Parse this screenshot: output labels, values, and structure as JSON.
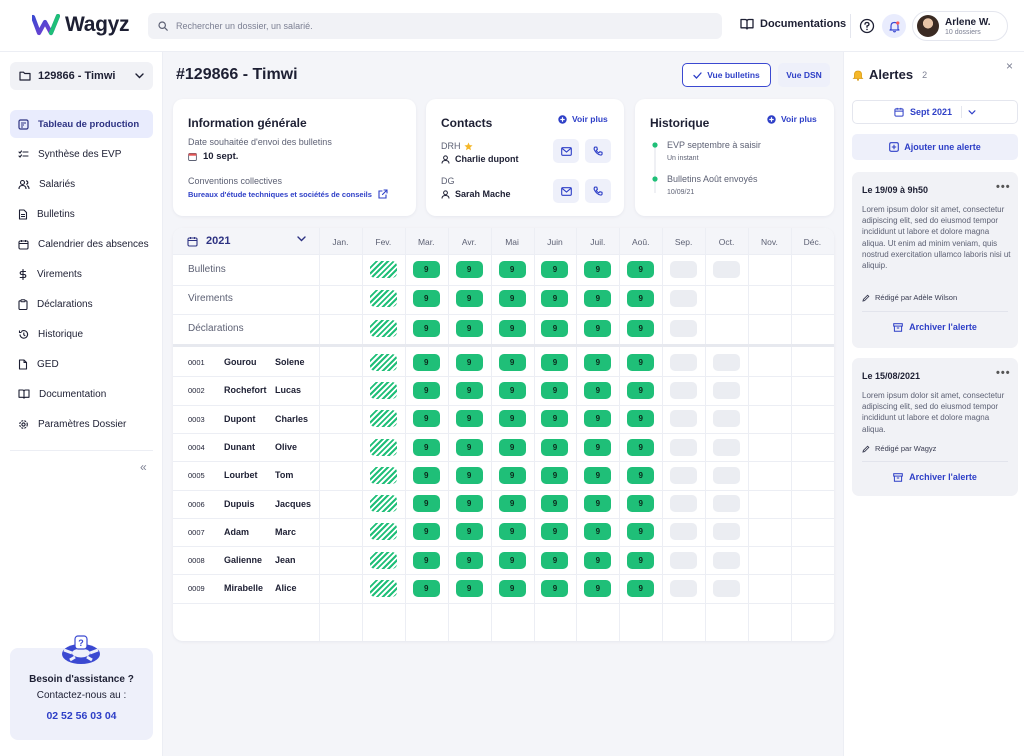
{
  "brand": {
    "name": "Wagyz"
  },
  "search": {
    "placeholder": "Rechercher un dossier, un salarié."
  },
  "header": {
    "documentations": "Documentations"
  },
  "user": {
    "name": "Arlene W.",
    "sub": "10 dossiers"
  },
  "sidebar": {
    "folder": "129866 - Timwi",
    "items": [
      {
        "label": "Tableau de production",
        "icon": "dashboard-icon",
        "active": true
      },
      {
        "label": "Synthèse des EVP",
        "icon": "tasks-icon"
      },
      {
        "label": "Salariés",
        "icon": "users-icon"
      },
      {
        "label": "Bulletins",
        "icon": "document-icon"
      },
      {
        "label": "Calendrier des absences",
        "icon": "calendar-icon"
      },
      {
        "label": "Virements",
        "icon": "dollar-icon"
      },
      {
        "label": "Déclarations",
        "icon": "clipboard-icon"
      },
      {
        "label": "Historique",
        "icon": "history-icon"
      },
      {
        "label": "GED",
        "icon": "file-icon"
      },
      {
        "label": "Documentation",
        "icon": "book-icon"
      },
      {
        "label": "Paramètres Dossier",
        "icon": "gear-icon"
      }
    ],
    "collapse": "«",
    "assist": {
      "title": "Besoin d'assistance ?",
      "sub": "Contactez-nous au :",
      "phone": "02 52 56 03 04"
    }
  },
  "main": {
    "title": "#129866 - Timwi",
    "btn_bulletins": "Vue bulletins",
    "btn_dsn": "Vue DSN",
    "info": {
      "title": "Information générale",
      "date_label": "Date souhaitée d'envoi des bulletins",
      "date_value": "10 sept.",
      "conv_label": "Conventions collectives",
      "conv_link": "Bureaux  d'étude techniques et sociétés de conseils"
    },
    "contacts": {
      "title": "Contacts",
      "voir": "Voir plus",
      "c1_role": "DRH",
      "c1_name": "Charlie dupont",
      "c2_role": "DG",
      "c2_name": "Sarah Mache"
    },
    "historique": {
      "title": "Historique",
      "voir": "Voir plus",
      "e1_title": "EVP septembre à saisir",
      "e1_time": "Un instant",
      "e2_title": "Bulletins Août envoyés",
      "e2_time": "10/09/21"
    }
  },
  "grid": {
    "year": "2021",
    "months": [
      "Jan.",
      "Fev.",
      "Mar.",
      "Avr.",
      "Mai",
      "Juin",
      "Juil.",
      "Aoû.",
      "Sep.",
      "Oct.",
      "Nov.",
      "Déc."
    ],
    "month_states": [
      "none",
      "hatched",
      "done",
      "done",
      "done",
      "done",
      "done",
      "done",
      "pending",
      "pending",
      "none",
      "none"
    ],
    "badge": "9",
    "categories": [
      "Bulletins",
      "Virements",
      "Déclarations"
    ],
    "category_states": [
      [
        "none",
        "hatched",
        "done",
        "done",
        "done",
        "done",
        "done",
        "done",
        "pending",
        "pending",
        "none",
        "none"
      ],
      [
        "none",
        "hatched",
        "done",
        "done",
        "done",
        "done",
        "done",
        "done",
        "pending",
        "none",
        "none",
        "none"
      ],
      [
        "none",
        "hatched",
        "done",
        "done",
        "done",
        "done",
        "done",
        "done",
        "pending",
        "none",
        "none",
        "none"
      ]
    ],
    "employees": [
      {
        "num": "0001",
        "last": "Gourou",
        "first": "Solene"
      },
      {
        "num": "0002",
        "last": "Rochefort",
        "first": "Lucas"
      },
      {
        "num": "0003",
        "last": "Dupont",
        "first": "Charles"
      },
      {
        "num": "0004",
        "last": "Dunant",
        "first": "Olive"
      },
      {
        "num": "0005",
        "last": "Lourbet",
        "first": "Tom"
      },
      {
        "num": "0006",
        "last": "Dupuis",
        "first": "Jacques"
      },
      {
        "num": "0007",
        "last": "Adam",
        "first": "Marc"
      },
      {
        "num": "0008",
        "last": "Galienne",
        "first": "Jean"
      },
      {
        "num": "0009",
        "last": "Mirabelle",
        "first": "Alice"
      }
    ],
    "employee_states": [
      "none",
      "hatched",
      "done",
      "done",
      "done",
      "done",
      "done",
      "done",
      "pending",
      "pending",
      "none",
      "none"
    ]
  },
  "alerts": {
    "title": "Alertes",
    "count": "2",
    "close": "×",
    "month": "Sept 2021",
    "add": "Ajouter une alerte",
    "items": [
      {
        "date": "Le 19/09 à 9h50",
        "body": "Lorem ipsum dolor sit amet, consectetur adipiscing elit, sed do eiusmod tempor incididunt ut labore et dolore magna aliqua. Ut enim ad minim veniam, quis nostrud exercitation ullamco laboris nisi ut aliquip.",
        "author": "Rédigé par Adèle Wilson",
        "archive": "Archiver l'alerte"
      },
      {
        "date": "Le 15/08/2021",
        "body": "Lorem ipsum dolor sit amet, consectetur adipiscing elit, sed do eiusmod tempor incididunt ut labore et dolore magna aliqua.",
        "author": "Rédigé par Wagyz",
        "archive": "Archiver l'alerte"
      }
    ]
  },
  "colors": {
    "accent": "#2e3fc7",
    "done": "#1fbf78",
    "pending": "#ebedf2"
  }
}
